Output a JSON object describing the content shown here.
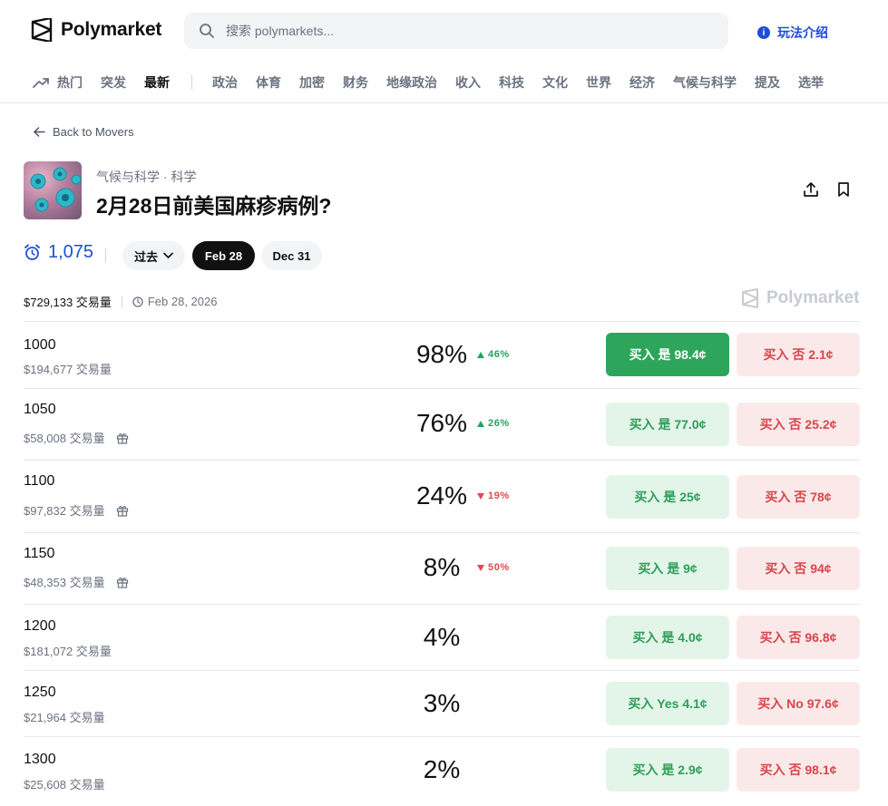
{
  "header": {
    "logo_text": "Polymarket",
    "search_placeholder": "搜索 polymarkets...",
    "howto_label": "玩法介绍"
  },
  "nav": {
    "items": [
      "热门",
      "突发",
      "最新"
    ],
    "categories": [
      "政治",
      "体育",
      "加密",
      "财务",
      "地缘政治",
      "收入",
      "科技",
      "文化",
      "世界",
      "经济",
      "气候与科学",
      "提及",
      "选举"
    ]
  },
  "back_label": "Back to Movers",
  "market": {
    "breadcrumb": "气候与科学 · 科学",
    "title": "2月28日前美国麻疹病例?",
    "count": "1,075",
    "tabs": [
      "过去",
      "Feb 28",
      "Dec 31"
    ],
    "total_volume": "$729,133 交易量",
    "end_date": "Feb 28, 2026",
    "watermark": "Polymarket"
  },
  "outcomes": [
    {
      "name": "1000",
      "volume": "$194,677 交易量",
      "gift": false,
      "pct": "98%",
      "change": "46%",
      "dir": "up",
      "yes": "买入 是 98.4¢",
      "no": "买入 否 2.1¢",
      "solid": true
    },
    {
      "name": "1050",
      "volume": "$58,008 交易量",
      "gift": true,
      "pct": "76%",
      "change": "26%",
      "dir": "up",
      "yes": "买入 是 77.0¢",
      "no": "买入 否 25.2¢",
      "solid": false
    },
    {
      "name": "1100",
      "volume": "$97,832 交易量",
      "gift": true,
      "pct": "24%",
      "change": "19%",
      "dir": "down",
      "yes": "买入 是 25¢",
      "no": "买入 否 78¢",
      "solid": false
    },
    {
      "name": "1150",
      "volume": "$48,353 交易量",
      "gift": true,
      "pct": "8%",
      "change": "50%",
      "dir": "down",
      "yes": "买入 是 9¢",
      "no": "买入 否 94¢",
      "solid": false
    },
    {
      "name": "1200",
      "volume": "$181,072 交易量",
      "gift": false,
      "pct": "4%",
      "change": "",
      "dir": "",
      "yes": "买入 是 4.0¢",
      "no": "买入 否 96.8¢",
      "solid": false
    },
    {
      "name": "1250",
      "volume": "$21,964 交易量",
      "gift": false,
      "pct": "3%",
      "change": "",
      "dir": "",
      "yes": "买入 Yes 4.1¢",
      "no": "买入 No 97.6¢",
      "solid": false
    },
    {
      "name": "1300",
      "volume": "$25,608 交易量",
      "gift": false,
      "pct": "2%",
      "change": "",
      "dir": "",
      "yes": "买入 是 2.9¢",
      "no": "买入 否 98.1¢",
      "solid": false
    }
  ],
  "colors": {
    "accent_blue": "#1d4ed8",
    "yes_green": "#2da55b",
    "no_red": "#d9444b"
  },
  "icons": [
    "polymarket-logo-icon",
    "search-icon",
    "info-icon",
    "trending-icon",
    "back-arrow-icon",
    "share-icon",
    "bookmark-icon",
    "alarm-icon",
    "chevron-down-icon",
    "clock-icon",
    "gift-icon",
    "triangle-up-icon",
    "triangle-down-icon"
  ]
}
